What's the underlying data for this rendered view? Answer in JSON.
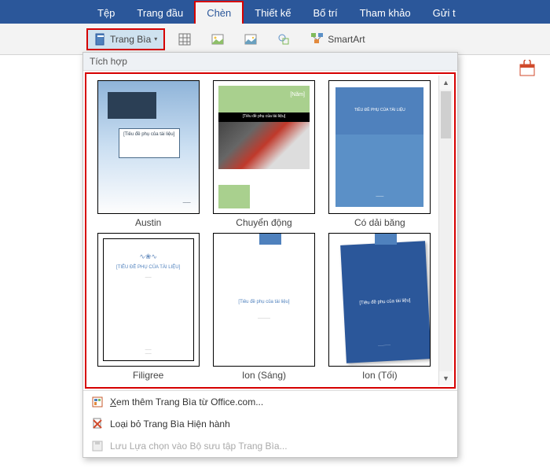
{
  "tabs": {
    "tep": "Tệp",
    "trangdau": "Trang đầu",
    "chen": "Chèn",
    "thietke": "Thiết kế",
    "botri": "Bố trí",
    "thamkhao": "Tham khảo",
    "guit": "Gửi t"
  },
  "ribbon": {
    "trangbia": "Trang Bìa",
    "smartart": "SmartArt"
  },
  "dropdown": {
    "header": "Tích hợp",
    "items": [
      {
        "label": "Austin",
        "subtitle": "[Tiêu đề phụ của tài liệu]"
      },
      {
        "label": "Chuyển động",
        "year": "[Năm]",
        "subtitle": "[Tiêu đề phụ của tài liệu]"
      },
      {
        "label": "Có dải băng",
        "subtitle": "TIÊU ĐỀ PHỤ CỦA TÀI LIỆU"
      },
      {
        "label": "Filigree",
        "title": "[TIÊU ĐỀ PHỤ CỦA TÀI LIỆU]"
      },
      {
        "label": "Ion (Sáng)",
        "subtitle": "[Tiêu đề phụ của tài liệu]"
      },
      {
        "label": "Ion (Tối)",
        "subtitle": "[Tiêu đề phụ của tài liệu]"
      }
    ],
    "menu": {
      "more": "Xem thêm Trang Bìa từ Office.com...",
      "remove": "Loại bỏ Trang Bìa Hiện hành",
      "save": "Lưu Lựa chọn vào Bộ sưu tập Trang Bìa..."
    }
  }
}
